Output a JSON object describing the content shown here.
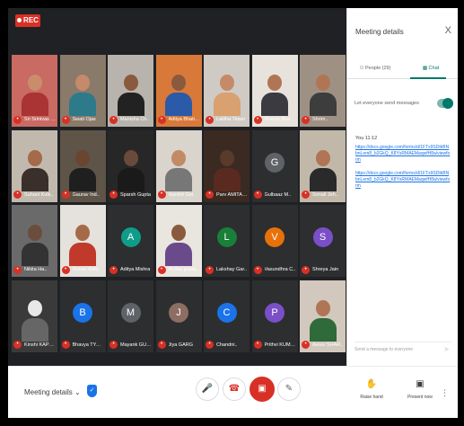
{
  "meeting": {
    "rec_label": "REC"
  },
  "participants": [
    {
      "name": "Sri Srinivas B..",
      "type": "video",
      "skin": "#c98d6c",
      "shirt": "#a33",
      "bg": "#c96a63"
    },
    {
      "name": "Swati Ojas",
      "type": "video",
      "skin": "#c48a6a",
      "shirt": "#2d7a8a",
      "bg": "#8a7a6a"
    },
    {
      "name": "Manisha Ch..",
      "type": "video",
      "skin": "#8a5a3e",
      "shirt": "#222",
      "bg": "#b9b3ad"
    },
    {
      "name": "Aditya Bhatia..",
      "type": "video",
      "skin": "#8a5a3e",
      "shirt": "#2a5aa8",
      "bg": "#d8793a"
    },
    {
      "name": "Lalitha Tiwari",
      "type": "video",
      "skin": "#c48a6a",
      "shirt": "#d9a070",
      "bg": "#cfcac4"
    },
    {
      "name": "Pranav Bhand..",
      "type": "video",
      "skin": "#b07555",
      "shirt": "#3a3a40",
      "bg": "#e7e2dc"
    },
    {
      "name": "Shrim..",
      "type": "video",
      "skin": "#b07555",
      "shirt": "#3d3d3d",
      "bg": "#9e9184"
    },
    {
      "name": "Suhani Kulk..",
      "type": "video",
      "skin": "#a56a4a",
      "shirt": "#3a2f2a",
      "bg": "#c1b9ad"
    },
    {
      "name": "Gaurav Ind..",
      "type": "video",
      "skin": "#6a4530",
      "shirt": "#1f1f1f",
      "bg": "#5e5448"
    },
    {
      "name": "Sparsh Gupta",
      "type": "video",
      "skin": "#6a4a3a",
      "shirt": "#1a1a1a",
      "bg": "#272727"
    },
    {
      "name": "Harshit Gol..",
      "type": "video",
      "skin": "#c38a66",
      "shirt": "#777",
      "bg": "#d9d4cc"
    },
    {
      "name": "Parv AMITAB..",
      "type": "video",
      "skin": "#5a3a2a",
      "shirt": "#5a2a20",
      "bg": "#3a2a22"
    },
    {
      "name": "Gulbaaz M..",
      "type": "avatar",
      "letter": "G",
      "color": "#5f6368"
    },
    {
      "name": "Sonali Jeh..",
      "type": "video",
      "skin": "#b07555",
      "shirt": "#2a2a2a",
      "bg": "#c2b8aa"
    },
    {
      "name": "Nikita Ha..",
      "type": "video",
      "skin": "#6b4d3d",
      "shirt": "#333",
      "bg": "#6a6a6a"
    },
    {
      "name": "Rohan Rahi..",
      "type": "video",
      "skin": "#a56a4a",
      "shirt": "#c0392b",
      "bg": "#e5e1dc"
    },
    {
      "name": "Aditya Mishra",
      "type": "avatar",
      "letter": "A",
      "color": "#0f9d8a"
    },
    {
      "name": "Anshu gupta..",
      "type": "video",
      "skin": "#8a5a3e",
      "shirt": "#6a4a8a",
      "bg": "#e9e5df"
    },
    {
      "name": "Lakshay Gar..",
      "type": "avatar",
      "letter": "L",
      "color": "#188038"
    },
    {
      "name": "Vasundhra C..",
      "type": "avatar",
      "letter": "V",
      "color": "#e8710a"
    },
    {
      "name": "Shreya Jain",
      "type": "avatar",
      "letter": "S",
      "color": "#7b4fc8"
    },
    {
      "name": "Kinshi KAPOOR",
      "type": "video",
      "skin": "#e8e8e8",
      "shirt": "#666",
      "bg": "#3a3a3a"
    },
    {
      "name": "Bhavya TYAGI",
      "type": "avatar",
      "letter": "B",
      "color": "#1a73e8"
    },
    {
      "name": "Mayank GUPTA",
      "type": "avatar",
      "letter": "M",
      "color": "#5f6368"
    },
    {
      "name": "Jiya GARG",
      "type": "avatar",
      "letter": "J",
      "color": "#8d6e63"
    },
    {
      "name": "Chandni..",
      "type": "avatar",
      "letter": "C",
      "color": "#1a73e8"
    },
    {
      "name": "Prithvi KUMAR",
      "type": "avatar",
      "letter": "P",
      "color": "#7b4fc8"
    },
    {
      "name": "Aarav SHAR..",
      "type": "video",
      "skin": "#b07555",
      "shirt": "#2f6a3a",
      "bg": "#d2c8bd"
    }
  ],
  "panel": {
    "title": "Meeting details",
    "close_glyph": "X",
    "tab_people": "People (29)",
    "tab_chat": "Chat",
    "toggle_label": "Let everyone send messages",
    "sender": "You 11:12",
    "links": [
      "https://docs.google.com/forms/d/1FTx9SDtkBNbnLem8_b2GkQ_K8YsRMAEMaqwfH8a/viewform",
      "https://docs.google.com/forms/d/1FTx9SDtkBNbnLem8_b2GkQ_K8YsRMAEMaqwfH8a/viewform"
    ],
    "input_placeholder": "Send a message to everyone"
  },
  "bottombar": {
    "meeting_details_label": "Meeting details",
    "raise_hand_label": "Raise hand",
    "present_now_label": "Present now"
  },
  "colors": {
    "accent": "#00796b",
    "danger": "#d93025",
    "stage_bg": "#202124"
  }
}
